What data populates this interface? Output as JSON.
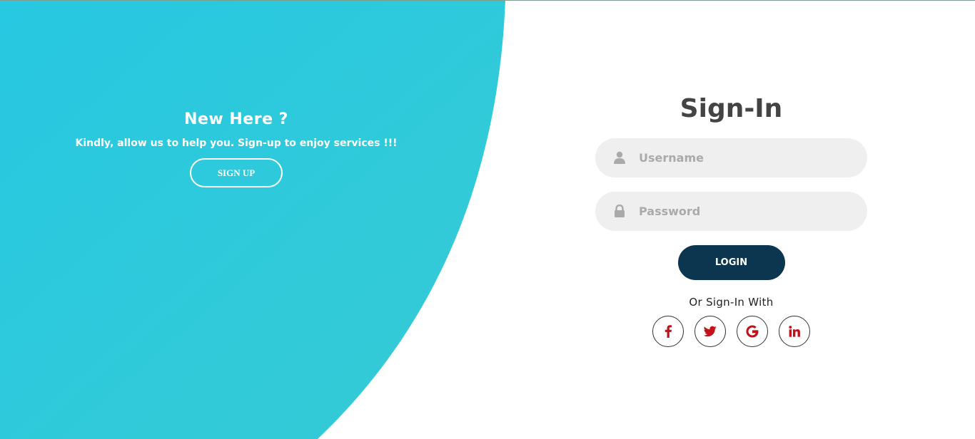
{
  "left": {
    "title": "New Here ?",
    "text": "Kindly, allow us to help you. Sign-up to enjoy services !!!",
    "signup_label": "SIGN UP"
  },
  "signin": {
    "title": "Sign-In",
    "username_placeholder": "Username",
    "username_icon": "user-icon",
    "password_placeholder": "Password",
    "password_icon": "lock-icon",
    "login_label": "LOGIN",
    "social_text": "Or Sign-In With",
    "social": [
      {
        "name": "facebook-icon"
      },
      {
        "name": "twitter-icon"
      },
      {
        "name": "google-icon"
      },
      {
        "name": "linkedin-icon"
      }
    ]
  },
  "colors": {
    "accent": "#2ec6dc",
    "login_button": "#0c3550",
    "social_icon": "#c1111a",
    "input_bg": "#efefef",
    "title": "#444444"
  }
}
